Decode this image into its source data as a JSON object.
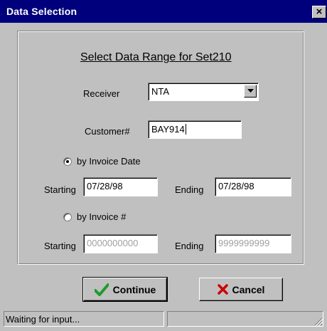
{
  "window": {
    "title": "Data Selection",
    "close_label": "×"
  },
  "form": {
    "heading": "Select Data Range for Set210",
    "receiver": {
      "label": "Receiver",
      "value": "NTA"
    },
    "customer": {
      "label": "Customer#",
      "value": "BAY914"
    },
    "by_date": {
      "label": "by Invoice Date",
      "selected": true,
      "starting_label": "Starting",
      "starting_value": "07/28/98",
      "ending_label": "Ending",
      "ending_value": "07/28/98"
    },
    "by_invoice": {
      "label": "by Invoice #",
      "selected": false,
      "starting_label": "Starting",
      "starting_value": "0000000000",
      "ending_label": "Ending",
      "ending_value": "9999999999"
    }
  },
  "buttons": {
    "continue_label": "Continue",
    "cancel_label": "Cancel"
  },
  "status": {
    "text": "Waiting for input..."
  },
  "icons": {
    "continue": "checkmark-icon",
    "cancel": "x-icon",
    "dropdown": "chevron-down-icon",
    "close": "close-icon"
  },
  "colors": {
    "titlebar": "#00007c",
    "face": "#c0c0c0",
    "check_green": "#1f9a2a",
    "cancel_red": "#cc0000"
  }
}
